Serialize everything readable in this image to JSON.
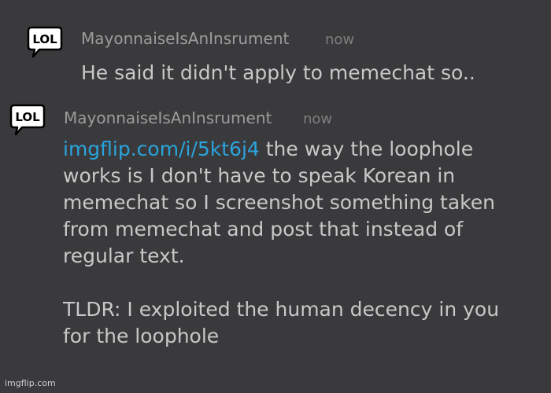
{
  "messages": [
    {
      "avatar_icon": "lol-speech-bubble-icon",
      "avatar_text": "LOL",
      "username": "MayonnaiseIsAnInsrument",
      "timestamp": "now",
      "lines": [
        "He said it didn't apply to memechat so.."
      ]
    },
    {
      "avatar_icon": "lol-speech-bubble-icon",
      "avatar_text": "LOL",
      "username": "MayonnaiseIsAnInsrument",
      "timestamp": "now",
      "link": "imgflip.com/i/5kt6j4",
      "line1_rest": " the way the loophole",
      "lines": [
        "works is I don't have to speak Korean in",
        "memechat so I screenshot something taken",
        "from memechat and post that instead of",
        "regular text.",
        "",
        "TLDR: I exploited the human decency in you",
        "for the loophole"
      ]
    }
  ],
  "watermark": "imgflip.com",
  "colors": {
    "background": "#3a3a3c",
    "username": "#9c9c9c",
    "timestamp": "#7e7e7e",
    "text": "#c8c8c8",
    "link": "#2aa4dc"
  }
}
